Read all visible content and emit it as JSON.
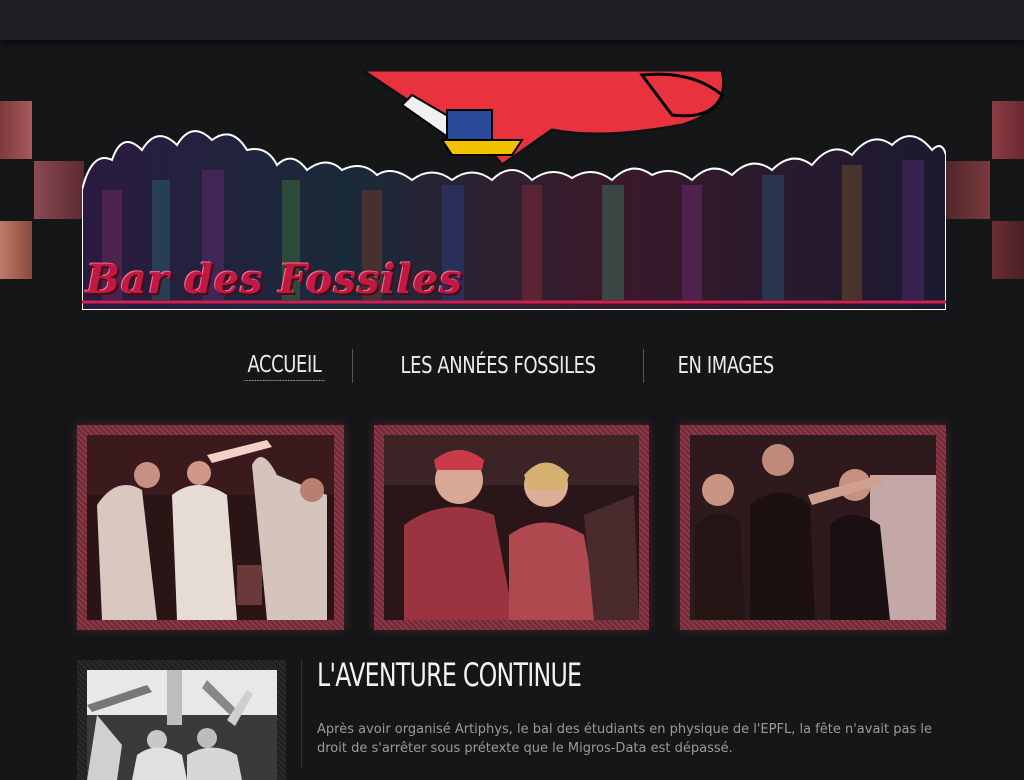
{
  "site": {
    "title": "Bar des Fossiles"
  },
  "nav": {
    "items": [
      {
        "label": "Accueil",
        "active": true
      },
      {
        "label": "Les années fossiles",
        "active": false
      },
      {
        "label": "En images",
        "active": false
      }
    ]
  },
  "gallery": {
    "photos": [
      {
        "icon": "party-photo-costumes"
      },
      {
        "icon": "party-photo-dancing-women"
      },
      {
        "icon": "party-photo-dance-floor"
      }
    ]
  },
  "article": {
    "title": "L'aventure continue",
    "text": "Après avoir organisé Artiphys, le bal des étudiants en physique de l'EPFL, la fête n'avait pas le droit de s'arrêter sous prétexte que le Migros-Data est dépassé.",
    "thumb_icon": "party-photo-black-white"
  },
  "colors": {
    "background": "#151618",
    "accent": "#c01a44",
    "frame": "#8a3a46"
  }
}
